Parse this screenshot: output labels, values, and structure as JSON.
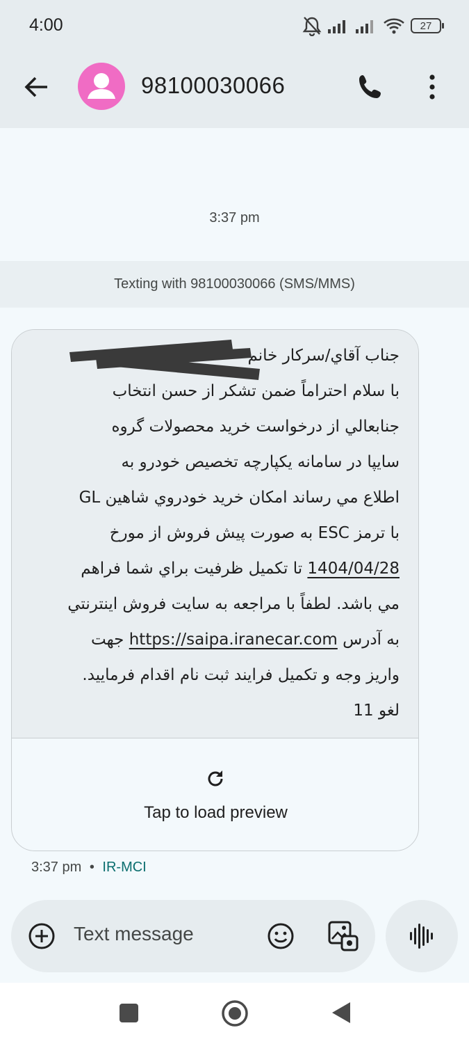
{
  "status_bar": {
    "time": "4:00",
    "battery": "27",
    "icons": [
      "mute-bell-icon",
      "signal-icon",
      "signal-icon",
      "wifi-icon",
      "battery-icon"
    ]
  },
  "header": {
    "contact_number": "98100030066",
    "avatar_color": "#f06cc4",
    "icons": [
      "back-arrow-icon",
      "avatar-icon",
      "phone-icon",
      "more-vert-icon"
    ]
  },
  "conversation": {
    "timestamp": "3:37 pm",
    "texting_banner": "Texting with 98100030066 (SMS/MMS)"
  },
  "message": {
    "lines": [
      "جناب آقاي/سركار خانم",
      "با سلام احتراماً ضمن تشكر از حسن انتخاب",
      "جنابعالي از درخواست خريد محصولات گروه",
      "سايپا در سامانه يكپارچه تخصيص خودرو به",
      "اطلاع مي رساند امكان خريد خودروي شاهين GL",
      "با ترمز ESC  به صورت پيش فروش از مورخ"
    ],
    "line7_date": "1404/04/28",
    "line7_rest": " تا تكميل ظرفيت براي شما فراهم",
    "line8": "مي باشد. لطفاً با مراجعه به سايت فروش اينترنتي",
    "line9_prefix": "به آدرس ",
    "link": "https://saipa.iranecar.com",
    "line9_suffix": "  جهت",
    "line10": "واريز وجه و تكميل فرايند ثبت نام اقدام فرماييد.",
    "line11": "لغو 11",
    "preview_label": "Tap to load preview",
    "time": "3:37 pm",
    "separator": "•",
    "carrier": "IR-MCI"
  },
  "compose": {
    "placeholder": "Text message",
    "icons": [
      "add-icon",
      "emoji-icon",
      "gallery-icon",
      "voice-icon"
    ]
  },
  "nav": {
    "icons": [
      "recents-icon",
      "home-icon",
      "back-icon"
    ]
  }
}
